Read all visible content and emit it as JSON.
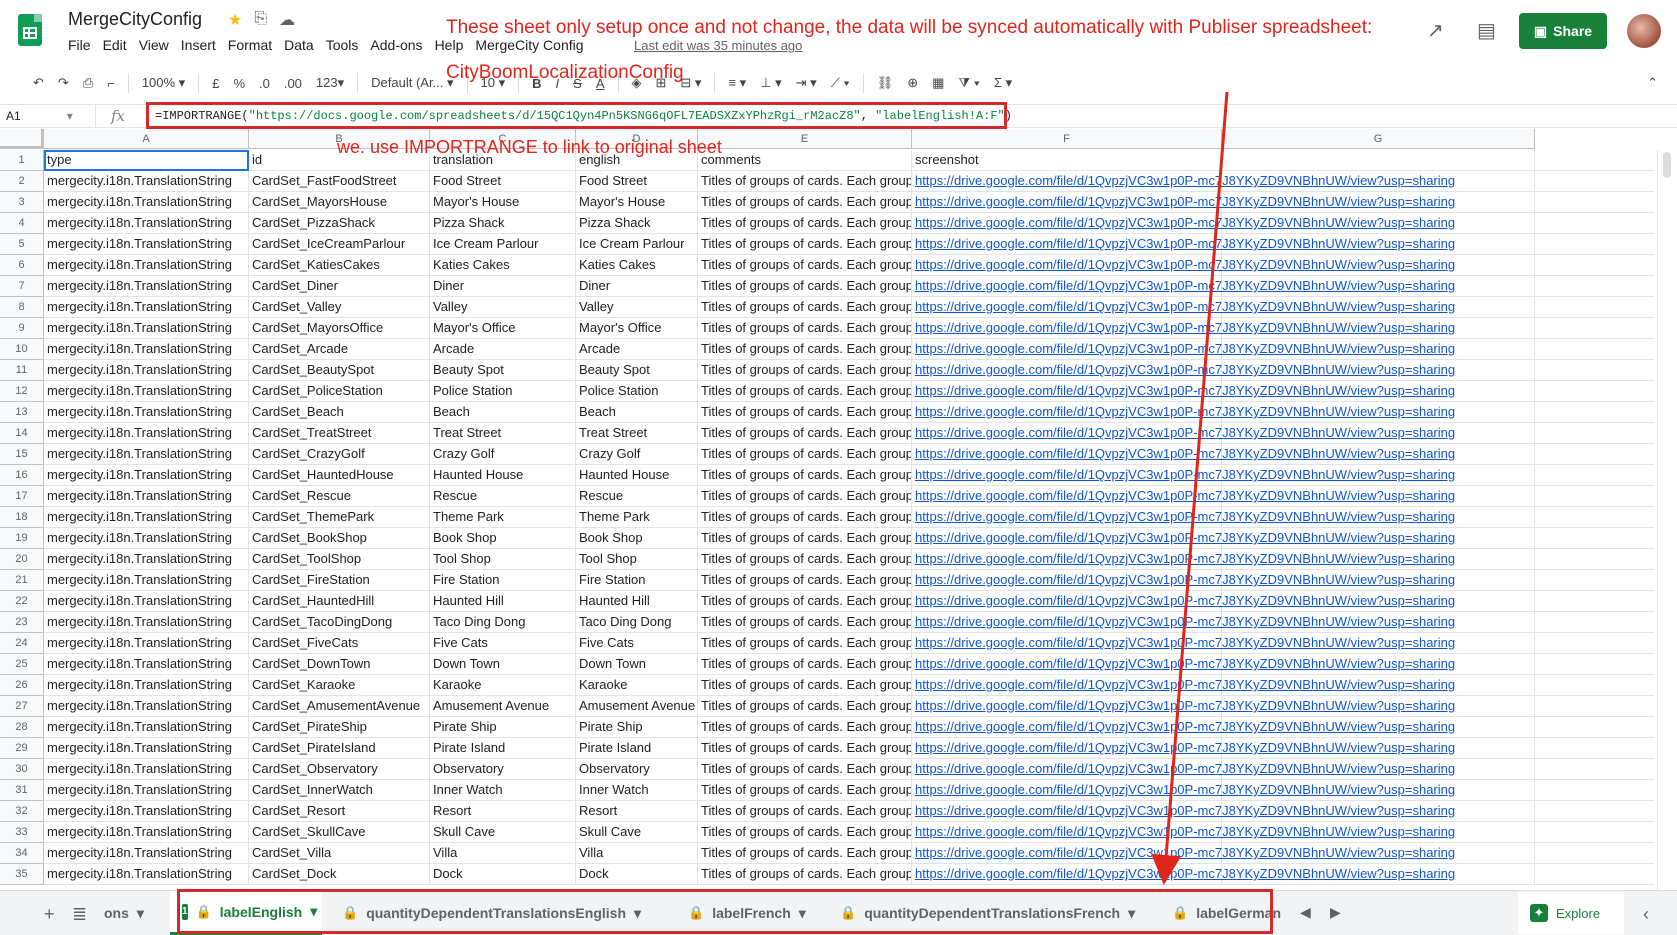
{
  "header": {
    "doc_title": "MergeCityConfig",
    "menu": [
      "File",
      "Edit",
      "View",
      "Insert",
      "Format",
      "Data",
      "Tools",
      "Add-ons",
      "Help",
      "MergeCity Config"
    ],
    "last_edit": "Last edit was 35 minutes ago",
    "share_label": "Share"
  },
  "toolbar": {
    "zoom": "100%",
    "currency": "£",
    "percent": "%",
    "dec_less": ".0",
    "dec_more": ".00",
    "format_more": "123",
    "font": "Default (Ar...",
    "font_size": "10",
    "bold": "B",
    "italic": "I",
    "strike": "S",
    "text_color": "A"
  },
  "formula_bar": {
    "cell_ref": "A1",
    "fx": "fx",
    "formula_prefix": "=IMPORTRANGE(",
    "formula_url": "\"https://docs.google.com/spreadsheets/d/15QC1Qyn4Pn5KSNG6qOFL7EADSXZxYPhzRgi_rM2acZ8\"",
    "formula_sep": ",  ",
    "formula_range": "\"labelEnglish!A:F\"",
    "formula_suffix": ")"
  },
  "columns": [
    "A",
    "B",
    "C",
    "D",
    "E",
    "F",
    "G"
  ],
  "table": {
    "headers": [
      "type",
      "id",
      "translation",
      "english",
      "comments",
      "screenshot"
    ],
    "type_value": "mergecity.i18n.TranslationString",
    "comment_value": "Titles of groups of cards. Each group c",
    "screenshot_value": "https://drive.google.com/file/d/1QvpzjVC3w1p0P-mc7J8YKyZD9VNBhnUW/view?usp=sharing",
    "rows": [
      {
        "id": "CardSet_FastFoodStreet",
        "translation": "Food Street",
        "english": "Food Street"
      },
      {
        "id": "CardSet_MayorsHouse",
        "translation": "Mayor's House",
        "english": "Mayor's House"
      },
      {
        "id": "CardSet_PizzaShack",
        "translation": "Pizza Shack",
        "english": "Pizza Shack"
      },
      {
        "id": "CardSet_IceCreamParlour",
        "translation": "Ice Cream Parlour",
        "english": "Ice Cream Parlour"
      },
      {
        "id": "CardSet_KatiesCakes",
        "translation": "Katies Cakes",
        "english": "Katies Cakes"
      },
      {
        "id": "CardSet_Diner",
        "translation": "Diner",
        "english": "Diner"
      },
      {
        "id": "CardSet_Valley",
        "translation": "Valley",
        "english": "Valley"
      },
      {
        "id": "CardSet_MayorsOffice",
        "translation": "Mayor's Office",
        "english": "Mayor's Office"
      },
      {
        "id": "CardSet_Arcade",
        "translation": "Arcade",
        "english": "Arcade"
      },
      {
        "id": "CardSet_BeautySpot",
        "translation": "Beauty Spot",
        "english": "Beauty Spot"
      },
      {
        "id": "CardSet_PoliceStation",
        "translation": "Police Station",
        "english": "Police Station"
      },
      {
        "id": "CardSet_Beach",
        "translation": "Beach",
        "english": "Beach"
      },
      {
        "id": "CardSet_TreatStreet",
        "translation": "Treat Street",
        "english": "Treat Street"
      },
      {
        "id": "CardSet_CrazyGolf",
        "translation": "Crazy Golf",
        "english": "Crazy Golf"
      },
      {
        "id": "CardSet_HauntedHouse",
        "translation": "Haunted House",
        "english": "Haunted House"
      },
      {
        "id": "CardSet_Rescue",
        "translation": "Rescue",
        "english": "Rescue"
      },
      {
        "id": "CardSet_ThemePark",
        "translation": "Theme Park",
        "english": "Theme Park"
      },
      {
        "id": "CardSet_BookShop",
        "translation": "Book Shop",
        "english": "Book Shop"
      },
      {
        "id": "CardSet_ToolShop",
        "translation": "Tool Shop",
        "english": "Tool Shop"
      },
      {
        "id": "CardSet_FireStation",
        "translation": "Fire Station",
        "english": "Fire Station"
      },
      {
        "id": "CardSet_HauntedHill",
        "translation": "Haunted Hill",
        "english": "Haunted Hill"
      },
      {
        "id": "CardSet_TacoDingDong",
        "translation": "Taco Ding Dong",
        "english": "Taco Ding Dong"
      },
      {
        "id": "CardSet_FiveCats",
        "translation": "Five Cats",
        "english": "Five Cats"
      },
      {
        "id": "CardSet_DownTown",
        "translation": "Down Town",
        "english": "Down Town"
      },
      {
        "id": "CardSet_Karaoke",
        "translation": "Karaoke",
        "english": "Karaoke"
      },
      {
        "id": "CardSet_AmusementAvenue",
        "translation": "Amusement Avenue",
        "english": "Amusement Avenue"
      },
      {
        "id": "CardSet_PirateShip",
        "translation": "Pirate Ship",
        "english": "Pirate Ship"
      },
      {
        "id": "CardSet_PirateIsland",
        "translation": "Pirate Island",
        "english": "Pirate Island"
      },
      {
        "id": "CardSet_Observatory",
        "translation": "Observatory",
        "english": "Observatory"
      },
      {
        "id": "CardSet_InnerWatch",
        "translation": "Inner Watch",
        "english": "Inner Watch"
      },
      {
        "id": "CardSet_Resort",
        "translation": "Resort",
        "english": "Resort"
      },
      {
        "id": "CardSet_SkullCave",
        "translation": "Skull Cave",
        "english": "Skull Cave"
      },
      {
        "id": "CardSet_Villa",
        "translation": "Villa",
        "english": "Villa"
      },
      {
        "id": "CardSet_Dock",
        "translation": "Dock",
        "english": "Dock"
      }
    ]
  },
  "tabs": {
    "partial_left": "ons",
    "items": [
      {
        "label": "labelEnglish",
        "badge": "1"
      },
      {
        "label": "quantityDependentTranslationsEnglish"
      },
      {
        "label": "labelFrench"
      },
      {
        "label": "quantityDependentTranslationsFrench"
      },
      {
        "label": "labelGerman"
      }
    ],
    "explore_label": "Explore"
  },
  "annotations": {
    "top_note": "These sheet only setup once and not change, the data will be synced automatically with Publiser spreadsheet:",
    "config_name": "CityBoomLocalizationConfig",
    "formula_note": "we. use IMPORTRANGE to link to original sheet",
    "color": "#e0251b"
  },
  "colors": {
    "brand_green": "#188038",
    "link_blue": "#1155cc",
    "selection_blue": "#1a73e8"
  }
}
